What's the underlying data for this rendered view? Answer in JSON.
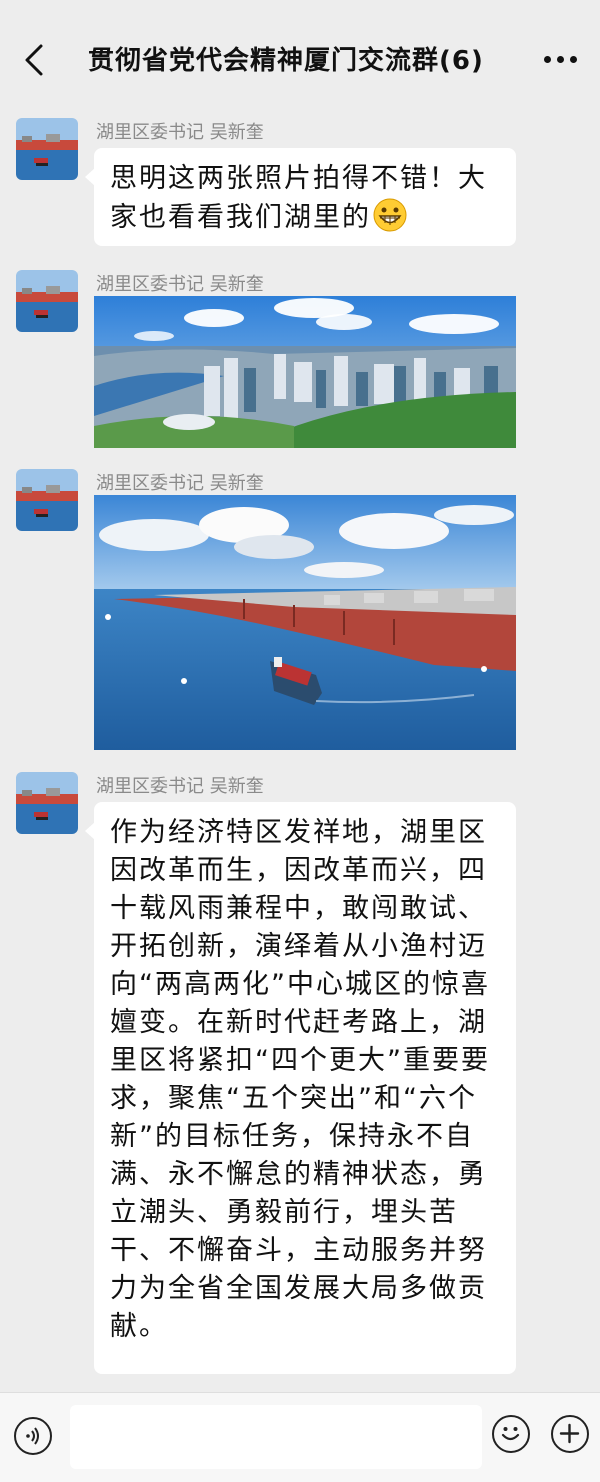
{
  "header": {
    "title": "贯彻省党代会精神厦门交流群(6)"
  },
  "messages": [
    {
      "sender": "湖里区委书记  吴新奎",
      "type": "text",
      "text": "思明这两张照片拍得不错！大家也看看我们湖里的",
      "emoji": "grinning-face"
    },
    {
      "sender": "湖里区委书记  吴新奎",
      "type": "image",
      "image": "aerial-city-skyline-photo"
    },
    {
      "sender": "湖里区委书记  吴新奎",
      "type": "image",
      "image": "container-port-photo"
    },
    {
      "sender": "湖里区委书记  吴新奎",
      "type": "text",
      "text": "作为经济特区发祥地，湖里区因改革而生，因改革而兴，四十载风雨兼程中，敢闯敢试、开拓创新，演绎着从小渔村迈向“两高两化”中心城区的惊喜嬗变。在新时代赶考路上，湖里区将紧扣“四个更大”重要要求，聚焦“五个突出”和“六个新”的目标任务，保持永不自满、永不懈怠的精神状态，勇立潮头、勇毅前行，埋头苦干、不懈奋斗，主动服务并努力为全省全国发展大局多做贡献。"
    }
  ],
  "input": {
    "value": "",
    "placeholder": ""
  },
  "icons": {
    "back": "back-arrow-icon",
    "more": "more-icon",
    "voice": "voice-icon",
    "emoji": "emoji-icon",
    "plus": "plus-icon"
  },
  "colors": {
    "background": "#ededed",
    "bubble": "#ffffff",
    "sender": "#8a8a8a"
  }
}
